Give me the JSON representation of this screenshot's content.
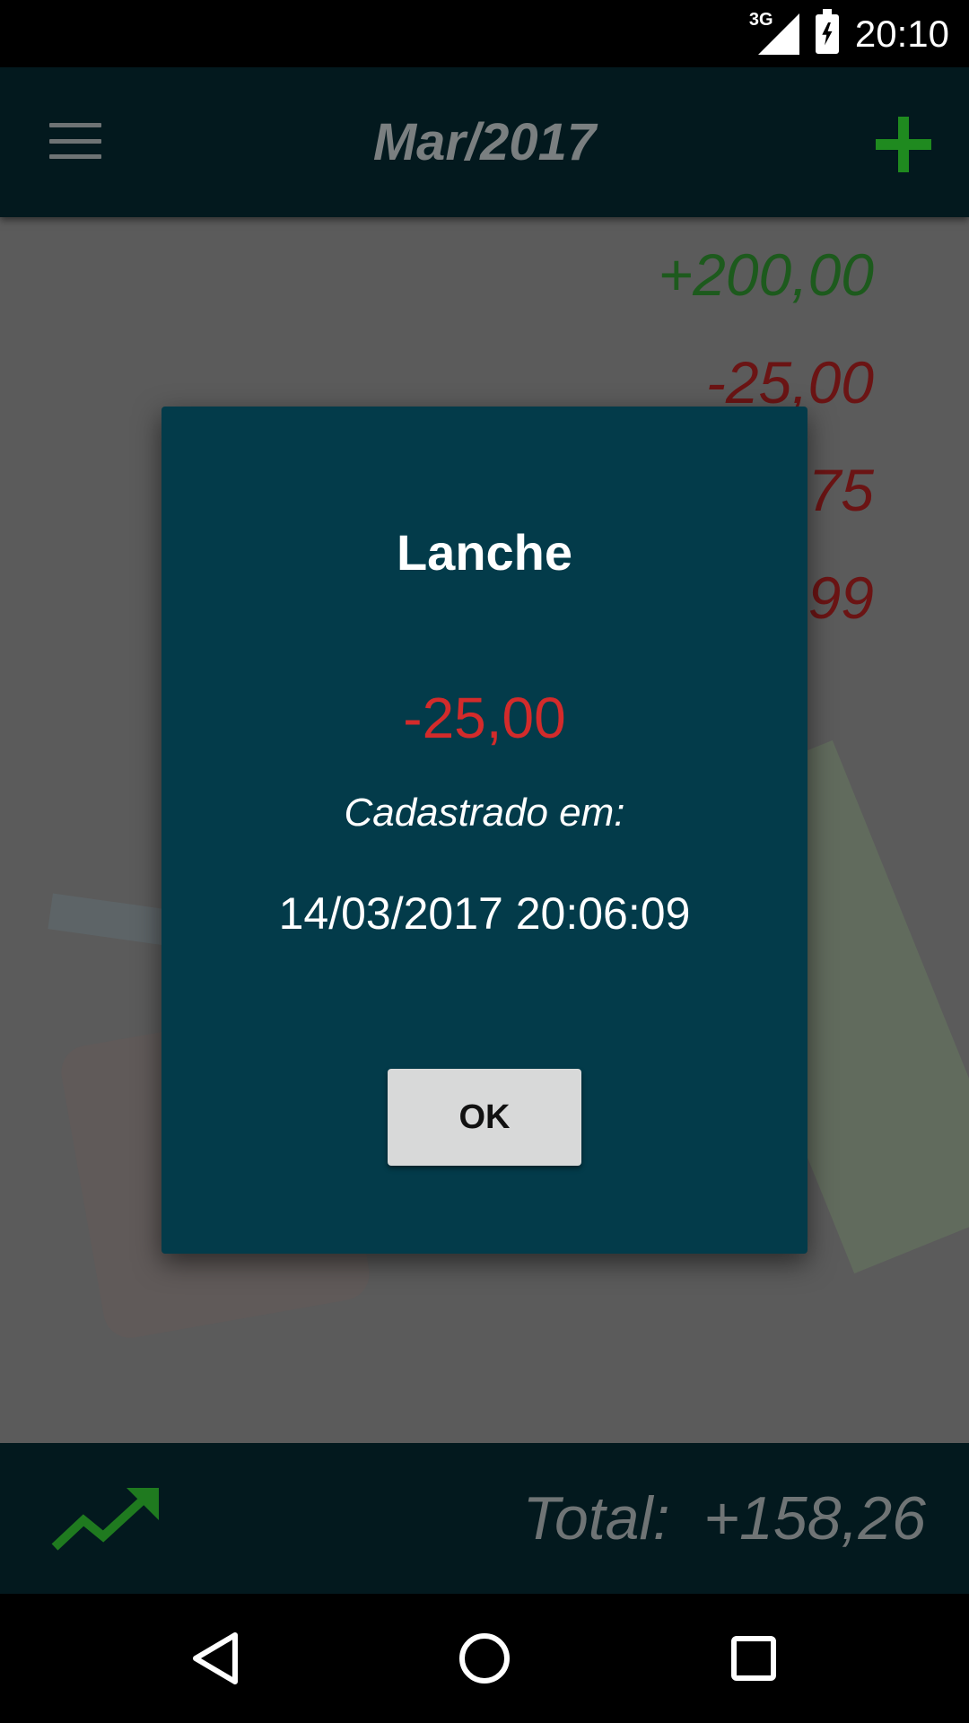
{
  "status_bar": {
    "network": "3G",
    "time": "20:10"
  },
  "toolbar": {
    "title": "Mar/2017"
  },
  "entries": [
    {
      "amount": "+200,00",
      "type": "positive"
    },
    {
      "amount": "-25,00",
      "type": "negative"
    },
    {
      "amount": "75",
      "type": "negative"
    },
    {
      "amount": "99",
      "type": "negative"
    }
  ],
  "footer": {
    "total_label": "Total:",
    "total_value": "+158,26"
  },
  "dialog": {
    "title": "Lanche",
    "amount": "-25,00",
    "registered_label": "Cadastrado em:",
    "registered_date": "14/03/2017 20:06:09",
    "ok_label": "OK"
  },
  "colors": {
    "accent_green": "#1f8a1f",
    "negative_red": "#d32b2b",
    "dialog_bg": "#033b4a",
    "toolbar_bg": "#03191e"
  },
  "icons": {
    "menu": "hamburger-menu-icon",
    "add": "plus-icon",
    "trend": "trending-up-icon",
    "back": "back-triangle-icon",
    "home": "home-circle-icon",
    "recents": "recents-square-icon"
  }
}
